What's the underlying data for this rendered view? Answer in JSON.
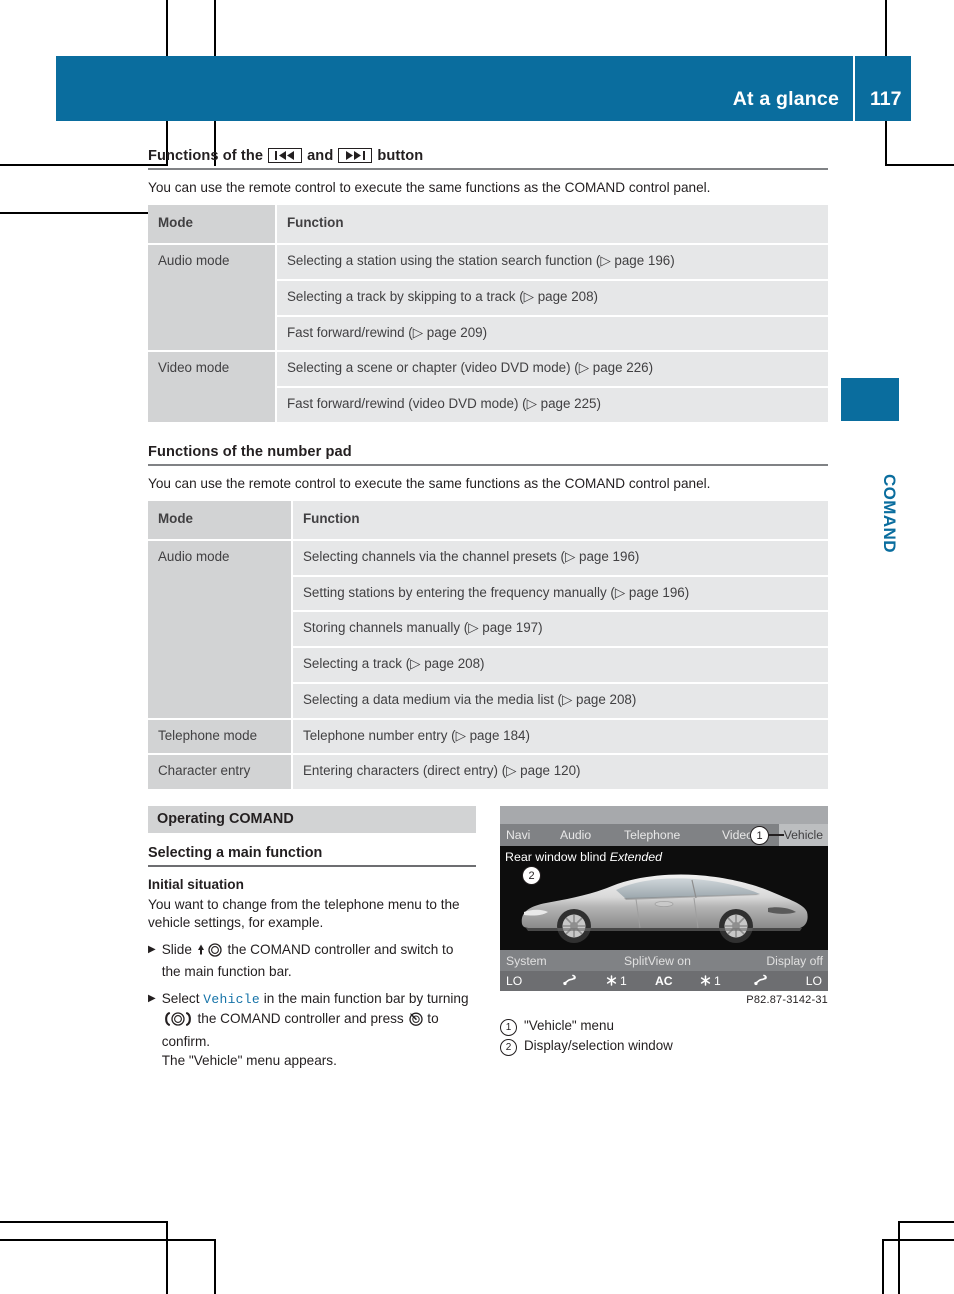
{
  "header": {
    "title": "At a glance",
    "page_number": "117",
    "band_color": "#0a6d9e"
  },
  "thumb_tab": {
    "label": "COMAND",
    "color": "#0a6d9e"
  },
  "sections": [
    {
      "heading_prefix": "Functions of the",
      "heading_mid": "and",
      "heading_suffix": "button",
      "icon_prev": "skip-backward-icon",
      "icon_next": "skip-forward-icon",
      "intro": "You can use the remote control to execute the same functions as the COMAND control panel.",
      "table": {
        "columns": [
          "Mode",
          "Function"
        ],
        "rows": [
          {
            "mode": "Audio mode",
            "rowspan": 3,
            "functions": [
              "Selecting a station using the station search function (▷ page 196)",
              "Selecting a track by skipping to a track (▷ page 208)",
              "Fast forward/rewind (▷ page 209)"
            ]
          },
          {
            "mode": "Video mode",
            "rowspan": 2,
            "functions": [
              "Selecting a scene or chapter (video DVD mode) (▷ page 226)",
              "Fast forward/rewind (video DVD mode) (▷ page 225)"
            ]
          }
        ]
      }
    },
    {
      "heading": "Functions of the number pad",
      "intro": "You can use the remote control to execute the same functions as the COMAND control panel.",
      "table": {
        "columns": [
          "Mode",
          "Function"
        ],
        "rows": [
          {
            "mode": "Audio mode",
            "rowspan": 5,
            "functions": [
              "Selecting channels via the channel presets (▷ page 196)",
              "Setting stations by entering the frequency manually (▷ page 196)",
              "Storing channels manually (▷ page 197)",
              "Selecting a track (▷ page 208)",
              "Selecting a data medium via the media list (▷ page 208)"
            ]
          },
          {
            "mode": "Telephone mode",
            "rowspan": 1,
            "functions": [
              "Telephone number entry (▷ page 184)"
            ]
          },
          {
            "mode": "Character entry",
            "rowspan": 1,
            "functions": [
              "Entering characters (direct entry) (▷ page 120)"
            ]
          }
        ]
      }
    }
  ],
  "operating": {
    "chapter_bar": "Operating COMAND",
    "heading": "Selecting a main function",
    "subheading": "Initial situation",
    "intro": "You want to change from the telephone menu to the vehicle settings, for example.",
    "steps": [
      {
        "text_before": "Slide",
        "control_icon": "comand-controller-slide-up-icon",
        "text_after": "the COMAND controller and switch to the main function bar."
      },
      {
        "text_before": "Select",
        "highlight": "Vehicle",
        "text_mid": "in the main function bar by turning",
        "control_icon": "comand-controller-turn-icon",
        "text_mid2": "the COMAND controller and press",
        "control_icon2": "comand-controller-press-icon",
        "text_after": "to confirm.",
        "text_result": "The \"Vehicle\" menu appears."
      }
    ]
  },
  "screen": {
    "menu_items": [
      "Navi",
      "Audio",
      "Telephone",
      "Video",
      "Vehicle"
    ],
    "selected_menu": "Vehicle",
    "stage_caption_label": "Rear window blind",
    "stage_caption_value": "Extended",
    "status_bar": [
      "System",
      "SplitView on",
      "Display off"
    ],
    "climate_bar": [
      "LO",
      "seat-airflow-icon",
      "fan-1-icon",
      "AC",
      "fan-1-icon",
      "seat-airflow-icon",
      "LO"
    ],
    "climate_fan_left": "1",
    "climate_fan_right": "1",
    "climate_ac": "AC",
    "climate_lo_left": "LO",
    "climate_lo_right": "LO",
    "image_code": "P82.87-3142-31",
    "callouts": [
      "1",
      "2"
    ]
  },
  "legend": [
    {
      "num": "1",
      "text": "\"Vehicle\" menu"
    },
    {
      "num": "2",
      "text": "Display/selection window"
    }
  ]
}
